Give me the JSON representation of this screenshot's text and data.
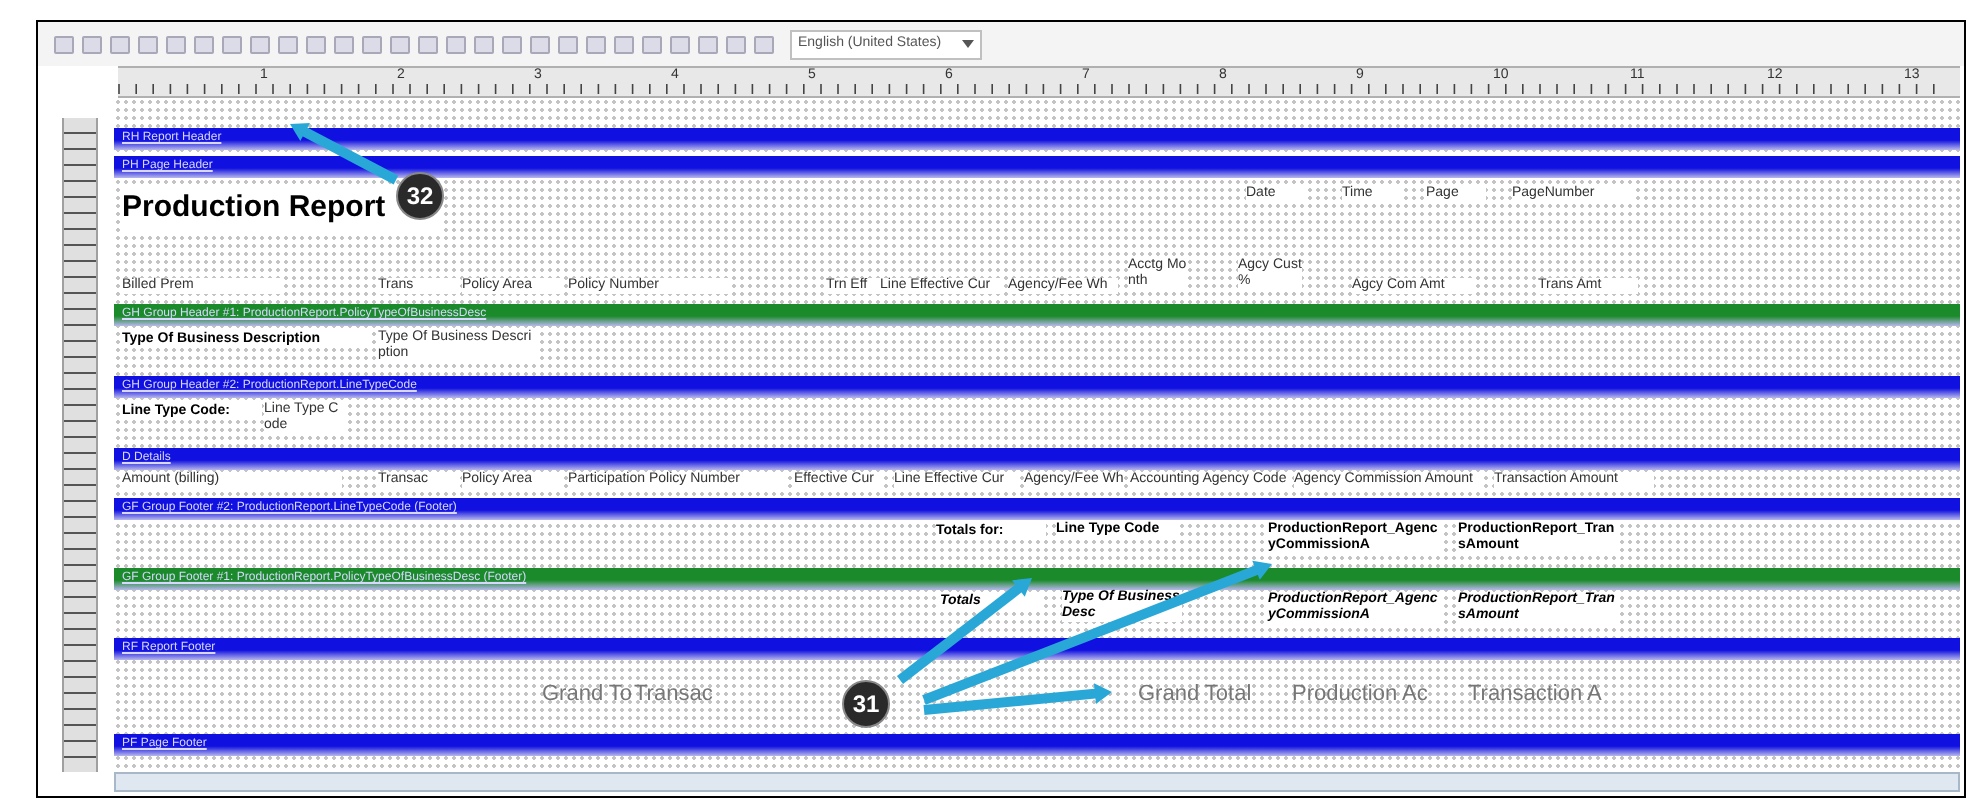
{
  "toolbar": {
    "language": "English (United States)"
  },
  "ruler": {
    "marks": [
      "1",
      "2",
      "3",
      "4",
      "5",
      "6",
      "7",
      "8",
      "9",
      "10",
      "11",
      "12",
      "13"
    ]
  },
  "sections": [
    {
      "kind": "band",
      "label": "RH Report Header",
      "color": "#1010e0"
    },
    {
      "kind": "band",
      "label": "PH Page Header",
      "color": "#1010e0"
    },
    {
      "kind": "content",
      "fields": [
        {
          "text": "Production Report"
        },
        {
          "text": "Date"
        },
        {
          "text": "Time"
        },
        {
          "text": "Page"
        },
        {
          "text": "PageNumber"
        },
        {
          "text": "Billed Prem"
        },
        {
          "text": "Trans"
        },
        {
          "text": "Policy Area"
        },
        {
          "text": "Policy Number"
        },
        {
          "text": "Trn Eff"
        },
        {
          "text": "Line Effective Cur"
        },
        {
          "text": "Agency/Fee Wh"
        },
        {
          "text": "Acctg Month"
        },
        {
          "text": "Agcy Cust %"
        },
        {
          "text": "Agcy Com Amt"
        },
        {
          "text": "Trans Amt"
        }
      ]
    },
    {
      "kind": "band",
      "label": "GH Group Header #1: ProductionReport.PolicyTypeOfBusinessDesc",
      "color": "#1a8a2a"
    },
    {
      "kind": "content",
      "fields": [
        {
          "text": "Type Of Business Description"
        },
        {
          "text": "Type Of Business Description"
        }
      ]
    },
    {
      "kind": "band",
      "label": "GH Group Header #2: ProductionReport.LineTypeCode",
      "color": "#1010e0"
    },
    {
      "kind": "content",
      "fields": [
        {
          "text": "Line Type Code:"
        },
        {
          "text": "Line Type Code"
        }
      ]
    },
    {
      "kind": "band",
      "label": "D Details",
      "color": "#1010e0"
    },
    {
      "kind": "content",
      "fields": [
        {
          "text": "Amount (billing)"
        },
        {
          "text": "Transac"
        },
        {
          "text": "Policy Area"
        },
        {
          "text": "Participation Policy Number"
        },
        {
          "text": "Effective Cur"
        },
        {
          "text": "Line Effective Cur"
        },
        {
          "text": "Agency/Fee Wh"
        },
        {
          "text": "Accounting Agency Code"
        },
        {
          "text": "Agency Commission Amount"
        },
        {
          "text": "Transaction Amount"
        }
      ]
    },
    {
      "kind": "band",
      "label": "GF Group Footer #2: ProductionReport.LineTypeCode (Footer)",
      "color": "#1010e0"
    },
    {
      "kind": "content",
      "fields": [
        {
          "text": "Totals for:"
        },
        {
          "text": "Line Type Code"
        },
        {
          "text": "ProductionReport_AgencyCommissionA"
        },
        {
          "text": "ProductionReport_TransAmount"
        }
      ]
    },
    {
      "kind": "band",
      "label": "GF Group Footer #1: ProductionReport.PolicyTypeOfBusinessDesc (Footer)",
      "color": "#1a8a2a"
    },
    {
      "kind": "content",
      "fields": [
        {
          "text": "Totals"
        },
        {
          "text": "Type Of Business Desc"
        },
        {
          "text": "ProductionReport_AgencyCommissionA"
        },
        {
          "text": "ProductionReport_TransAmount"
        }
      ]
    },
    {
      "kind": "band",
      "label": "RF Report Footer",
      "color": "#1010e0"
    },
    {
      "kind": "content",
      "fields": [
        {
          "text": "Grand To"
        },
        {
          "text": "Transac"
        },
        {
          "text": "Grand Total"
        },
        {
          "text": "Production Ac"
        },
        {
          "text": "Transaction A"
        }
      ]
    },
    {
      "kind": "band",
      "label": "PF Page Footer",
      "color": "#1010e0"
    }
  ],
  "callouts": [
    {
      "number": "32"
    },
    {
      "number": "31"
    }
  ]
}
